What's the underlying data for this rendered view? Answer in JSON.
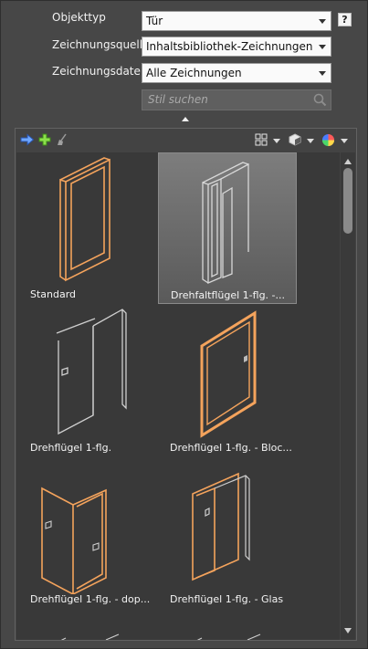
{
  "fields": {
    "objekttyp": {
      "label": "Objekttyp",
      "value": "Tür"
    },
    "zeichnungsquelle": {
      "label": "Zeichnungsquelle",
      "value": "Inhaltsbibliothek-Zeichnungen"
    },
    "zeichnungsdatei": {
      "label": "Zeichnungsdatei",
      "value": "Alle Zeichnungen"
    }
  },
  "help": {
    "label": "?"
  },
  "search": {
    "placeholder": "Stil suchen"
  },
  "styles": [
    {
      "label": "Standard",
      "selected": false
    },
    {
      "label": "Drehfaltflügel 1-flg. -...",
      "selected": true
    },
    {
      "label": "Drehflügel 1-flg.",
      "selected": false
    },
    {
      "label": "Drehflügel 1-flg. - Bloc...",
      "selected": false
    },
    {
      "label": "Drehflügel 1-flg. - dop...",
      "selected": false
    },
    {
      "label": "Drehflügel 1-flg. - Glas",
      "selected": false
    }
  ],
  "colors": {
    "accent_orange": "#f4a35c",
    "line_grey": "#cfcfcf"
  },
  "icons": [
    "import-arrow-icon",
    "add-plus-icon",
    "purge-broom-icon",
    "view-grid-icon",
    "display-style-icon",
    "color-wheel-icon",
    "search-icon"
  ]
}
